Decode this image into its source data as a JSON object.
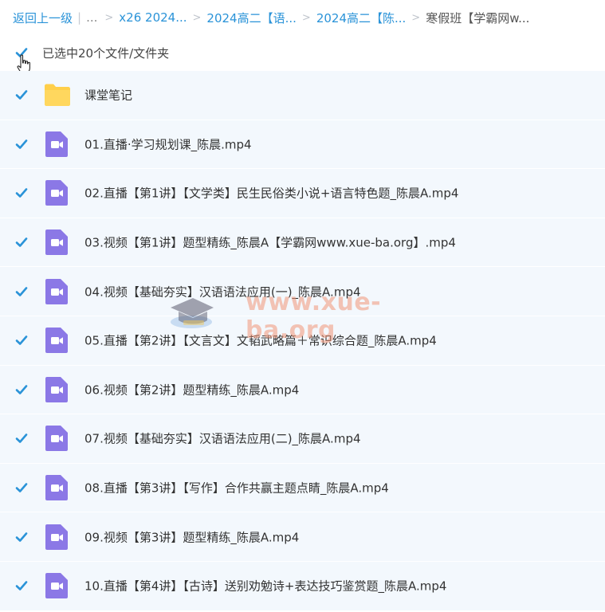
{
  "breadcrumb": {
    "back": "返回上一级",
    "ellipsis": "...",
    "items": [
      "x26 2024...",
      "2024高二【语...",
      "2024高二【陈..."
    ],
    "current": "寒假班【学霸网w..."
  },
  "selection": {
    "label": "已选中20个文件/文件夹",
    "checked": true
  },
  "files": [
    {
      "name": "课堂笔记",
      "type": "folder"
    },
    {
      "name": "01.直播·学习规划课_陈晨.mp4",
      "type": "video"
    },
    {
      "name": "02.直播【第1讲】【文学类】民生民俗类小说+语言特色题_陈晨A.mp4",
      "type": "video"
    },
    {
      "name": "03.视频【第1讲】题型精练_陈晨A【学霸网www.xue-ba.org】.mp4",
      "type": "video"
    },
    {
      "name": "04.视频【基础夯实】汉语语法应用(一)_陈晨A.mp4",
      "type": "video"
    },
    {
      "name": "05.直播【第2讲】【文言文】文韬武略篇＋常识综合题_陈晨A.mp4",
      "type": "video"
    },
    {
      "name": "06.视频【第2讲】题型精练_陈晨A.mp4",
      "type": "video"
    },
    {
      "name": "07.视频【基础夯实】汉语语法应用(二)_陈晨A.mp4",
      "type": "video"
    },
    {
      "name": "08.直播【第3讲】【写作】合作共赢主题点睛_陈晨A.mp4",
      "type": "video"
    },
    {
      "name": "09.视频【第3讲】题型精练_陈晨A.mp4",
      "type": "video"
    },
    {
      "name": "10.直播【第4讲】【古诗】送别劝勉诗+表达技巧鉴赏题_陈晨A.mp4",
      "type": "video"
    }
  ],
  "watermark": {
    "text": "www.xue-ba.org"
  },
  "colors": {
    "link": "#2a93d8",
    "checkbox": "#2a93d8",
    "row_bg": "#f3f8fd",
    "folder": "#ffcf4a",
    "video": "#8b78e6"
  }
}
